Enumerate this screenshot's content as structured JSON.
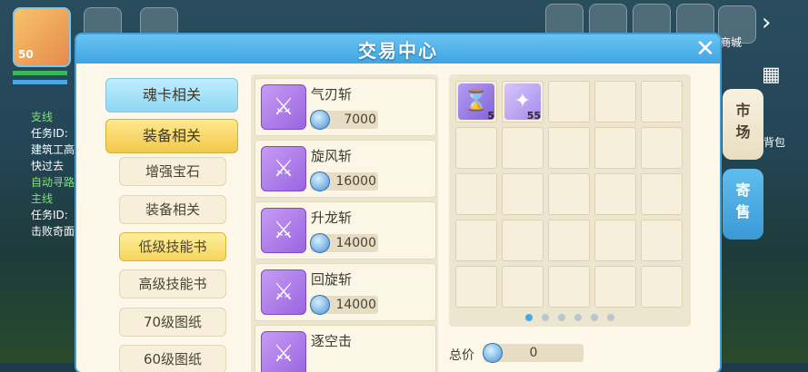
{
  "hud": {
    "level": "50",
    "quest_lines": [
      "支线",
      "任务ID:",
      "建筑工高",
      "快过去",
      "自动寻路",
      "主线",
      "任务ID:",
      "击败奇面"
    ],
    "right_labels": [
      "商城",
      "背包"
    ]
  },
  "modal": {
    "title": "交易中心",
    "close_icon": "close-icon"
  },
  "categories": {
    "soul_card": "魂卡相关",
    "equipment": "装备相关",
    "sub": [
      "增强宝石",
      "装备相关",
      "低级技能书",
      "高级技能书",
      "70级图纸",
      "60级图纸"
    ]
  },
  "items": [
    {
      "name": "气刃斩",
      "price": "7000"
    },
    {
      "name": "旋风斩",
      "price": "16000"
    },
    {
      "name": "升龙斩",
      "price": "14000"
    },
    {
      "name": "回旋斩",
      "price": "14000"
    },
    {
      "name": "逐空击",
      "price": ""
    }
  ],
  "inventory": {
    "slots": [
      {
        "icon": "hourglass-icon",
        "count": "5"
      },
      {
        "icon": "feather-icon",
        "count": "55"
      }
    ],
    "pages": 6,
    "current_page": 1
  },
  "total": {
    "label": "总价",
    "value": "0"
  },
  "side_tabs": {
    "market": "市场",
    "consign": "寄售"
  },
  "colors": {
    "header": "#3fa5e3",
    "gold_button": "#f2c94d",
    "blue_button": "#8fd6f1",
    "skillbook": "#9a64e0"
  }
}
